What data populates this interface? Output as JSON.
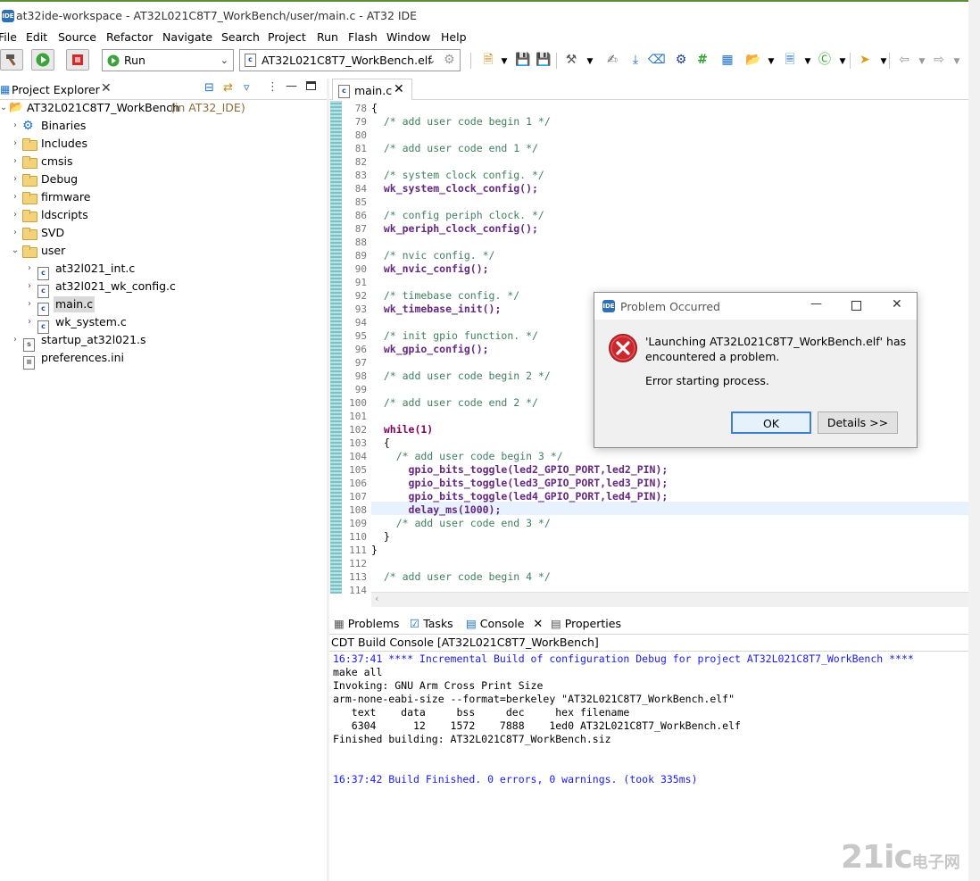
{
  "window": {
    "title": "at32ide-workspace - AT32L021C8T7_WorkBench/user/main.c - AT32 IDE",
    "app_icon": "IDE"
  },
  "menu": [
    "File",
    "Edit",
    "Source",
    "Refactor",
    "Navigate",
    "Search",
    "Project",
    "Run",
    "Flash",
    "Window",
    "Help"
  ],
  "toolbar": {
    "run_mode": "Run",
    "launch_target": "AT32L021C8T7_WorkBench.elf"
  },
  "project_explorer": {
    "title": "Project Explorer",
    "project": {
      "name": "AT32L021C8T7_WorkBench",
      "suffix": "(in AT32_IDE)"
    },
    "items": [
      {
        "label": "Binaries",
        "icon": "binaries-icon"
      },
      {
        "label": "Includes",
        "icon": "includes-icon"
      },
      {
        "label": "cmsis",
        "icon": "folder-icon"
      },
      {
        "label": "Debug",
        "icon": "folder-icon"
      },
      {
        "label": "firmware",
        "icon": "folder-icon"
      },
      {
        "label": "ldscripts",
        "icon": "folder-icon"
      },
      {
        "label": "SVD",
        "icon": "folder-icon"
      },
      {
        "label": "user",
        "icon": "folder-icon"
      }
    ],
    "user_children": [
      "at32l021_int.c",
      "at32l021_wk_config.c",
      "main.c",
      "wk_system.c"
    ],
    "after": [
      "startup_at32l021.s",
      "preferences.ini"
    ]
  },
  "editor": {
    "tab": "main.c",
    "line_numbers": [
      "78",
      "79",
      "80",
      "81",
      "82",
      "83",
      "84",
      "85",
      "86",
      "87",
      "88",
      "89",
      "90",
      "91",
      "92",
      "93",
      "94",
      "95",
      "96",
      "97",
      "98",
      "99",
      "100",
      "101",
      "102",
      "103",
      "104",
      "105",
      "106",
      "107",
      "108",
      "109",
      "110",
      "111",
      "112",
      "113",
      "114"
    ],
    "lines": [
      "{",
      "  /* add user code begin 1 */",
      "",
      "  /* add user code end 1 */",
      "",
      "  /* system clock config. */",
      "  wk_system_clock_config();",
      "",
      "  /* config periph clock. */",
      "  wk_periph_clock_config();",
      "",
      "  /* nvic config. */",
      "  wk_nvic_config();",
      "",
      "  /* timebase config. */",
      "  wk_timebase_init();",
      "",
      "  /* init gpio function. */",
      "  wk_gpio_config();",
      "",
      "  /* add user code begin 2 */",
      "",
      "  /* add user code end 2 */",
      "",
      "  while(1)",
      "  {",
      "    /* add user code begin 3 */",
      "      gpio_bits_toggle(led2_GPIO_PORT,led2_PIN);",
      "      gpio_bits_toggle(led3_GPIO_PORT,led3_PIN);",
      "      gpio_bits_toggle(led4_GPIO_PORT,led4_PIN);",
      "      delay_ms(1000);",
      "    /* add user code end 3 */",
      "  }",
      "}",
      "",
      "  /* add user code begin 4 */",
      ""
    ]
  },
  "bottom_panel": {
    "tabs": [
      "Problems",
      "Tasks",
      "Console",
      "Properties"
    ],
    "console_title": "CDT Build Console [AT32L021C8T7_WorkBench]",
    "lines": [
      "16:37:41 **** Incremental Build of configuration Debug for project AT32L021C8T7_WorkBench ****",
      "make all",
      "Invoking: GNU Arm Cross Print Size",
      "arm-none-eabi-size --format=berkeley \"AT32L021C8T7_WorkBench.elf\"",
      "   text    data     bss     dec     hex filename",
      "   6304      12    1572    7888    1ed0 AT32L021C8T7_WorkBench.elf",
      "Finished building: AT32L021C8T7_WorkBench.siz",
      "",
      "",
      "16:37:42 Build Finished. 0 errors, 0 warnings. (took 335ms)"
    ]
  },
  "dialog": {
    "title": "Problem Occurred",
    "message_line1": "'Launching AT32L021C8T7_WorkBench.elf' has",
    "message_line2": "encountered a problem.",
    "detail": "Error starting process.",
    "ok_label": "OK",
    "details_label": "Details >>"
  },
  "watermark": {
    "text": "21ic",
    "cn": "电子网"
  }
}
